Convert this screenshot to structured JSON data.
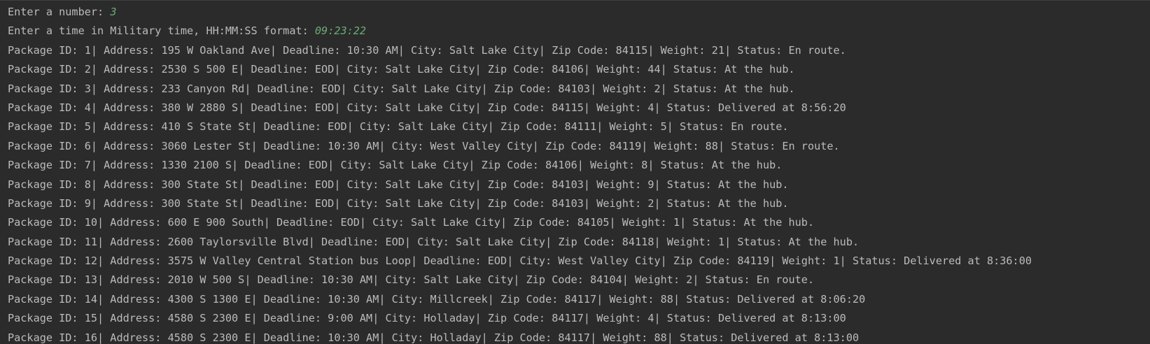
{
  "prompts": {
    "number_prompt": "Enter a number: ",
    "number_input": "3",
    "time_prompt": "Enter a time in Military time, HH:MM:SS format: ",
    "time_input": "09:23:22"
  },
  "colors": {
    "background": "#2b2b2b",
    "output_text": "#bbbbbb",
    "user_input": "#6aab73"
  },
  "packages": [
    "Package ID: 1| Address: 195 W Oakland Ave| Deadline: 10:30 AM| City: Salt Lake City| Zip Code: 84115| Weight: 21| Status: En route.",
    "Package ID: 2| Address: 2530 S 500 E| Deadline: EOD| City: Salt Lake City| Zip Code: 84106| Weight: 44| Status: At the hub.",
    "Package ID: 3| Address: 233 Canyon Rd| Deadline: EOD| City: Salt Lake City| Zip Code: 84103| Weight: 2| Status: At the hub.",
    "Package ID: 4| Address: 380 W 2880 S| Deadline: EOD| City: Salt Lake City| Zip Code: 84115| Weight: 4| Status: Delivered at 8:56:20",
    "Package ID: 5| Address: 410 S State St| Deadline: EOD| City: Salt Lake City| Zip Code: 84111| Weight: 5| Status: En route.",
    "Package ID: 6| Address: 3060 Lester St| Deadline: 10:30 AM| City: West Valley City| Zip Code: 84119| Weight: 88| Status: En route.",
    "Package ID: 7| Address: 1330 2100 S| Deadline: EOD| City: Salt Lake City| Zip Code: 84106| Weight: 8| Status: At the hub.",
    "Package ID: 8| Address: 300 State St| Deadline: EOD| City: Salt Lake City| Zip Code: 84103| Weight: 9| Status: At the hub.",
    "Package ID: 9| Address: 300 State St| Deadline: EOD| City: Salt Lake City| Zip Code: 84103| Weight: 2| Status: At the hub.",
    "Package ID: 10| Address: 600 E 900 South| Deadline: EOD| City: Salt Lake City| Zip Code: 84105| Weight: 1| Status: At the hub.",
    "Package ID: 11| Address: 2600 Taylorsville Blvd| Deadline: EOD| City: Salt Lake City| Zip Code: 84118| Weight: 1| Status: At the hub.",
    "Package ID: 12| Address: 3575 W Valley Central Station bus Loop| Deadline: EOD| City: West Valley City| Zip Code: 84119| Weight: 1| Status: Delivered at 8:36:00",
    "Package ID: 13| Address: 2010 W 500 S| Deadline: 10:30 AM| City: Salt Lake City| Zip Code: 84104| Weight: 2| Status: En route.",
    "Package ID: 14| Address: 4300 S 1300 E| Deadline: 10:30 AM| City: Millcreek| Zip Code: 84117| Weight: 88| Status: Delivered at 8:06:20",
    "Package ID: 15| Address: 4580 S 2300 E| Deadline: 9:00 AM| City: Holladay| Zip Code: 84117| Weight: 4| Status: Delivered at 8:13:00",
    "Package ID: 16| Address: 4580 S 2300 E| Deadline: 10:30 AM| City: Holladay| Zip Code: 84117| Weight: 88| Status: Delivered at 8:13:00"
  ]
}
